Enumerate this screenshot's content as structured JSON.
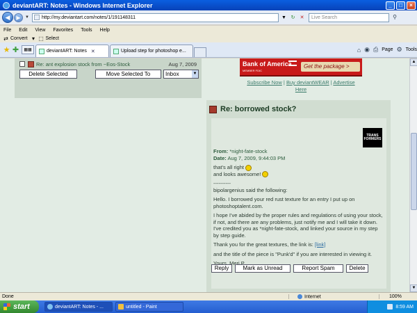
{
  "window": {
    "title": "deviantART: Notes - Windows Internet Explorer"
  },
  "address": {
    "url": "http://my.deviantart.com/notes/1/191148311",
    "search_placeholder": "Live Search"
  },
  "menu": {
    "items": [
      "File",
      "Edit",
      "View",
      "Favorites",
      "Tools",
      "Help"
    ]
  },
  "links_toolbar": {
    "convert": "Convert",
    "select": "Select"
  },
  "tabs": [
    {
      "label": "deviantART: Notes"
    },
    {
      "label": "Upload step for photoshop e..."
    }
  ],
  "command_bar": {
    "page": "Page",
    "tools": "Tools"
  },
  "list": {
    "row": {
      "from": "Re: ant explosion stock from ~Eos-Stock",
      "date": "Aug 7, 2009"
    },
    "delete_selected": "Delete Selected",
    "move_selected": "Move Selected To",
    "folder": "Inbox"
  },
  "ad": {
    "bank": "Bank of America",
    "member": "MEMBER FDIC",
    "cta": "Get the package >",
    "links": [
      "Subscribe Now",
      "Buy deviantWEAR",
      "Advertise",
      "Here"
    ],
    "sep": "|"
  },
  "note": {
    "title": "Re: borrowed stock?",
    "avatar_text": [
      "TRANS",
      "FORMERS"
    ],
    "from_label": "From:",
    "from": "*night-fate-stock",
    "date_label": "Date:",
    "date": "Aug 7, 2009, 9:44:03 PM",
    "line1": "that's all right",
    "line2": "and looks awesome!",
    "divider": "----------",
    "quote_intro": "bipolargenius said the following:",
    "para1": "Hello. I borrowed your red rust texture for an entry I put up on photoshoptalent.com.",
    "para2": "I hope I've abided by the proper rules and regulations of using your stock, if not, and there are any problems, just notify me and I will take it down.",
    "para3": "I've credited you as *night-fate-stock, and linked your source in my step by step guide.",
    "para4_prefix": "Thank you for the great textures, the link is: ",
    "para4_link": "[link]",
    "para5": "and the title of the piece is \"Punk'd\" if you are interested in viewing it.",
    "signoff": "Yours, Meri P.",
    "actions": [
      "Reply",
      "Mark as Unread",
      "Report Spam",
      "Delete"
    ]
  },
  "status": {
    "text": "Done",
    "zone": "Internet",
    "zoom": "100%"
  },
  "taskbar": {
    "start": "start",
    "tasks": [
      "deviantART: Notes - ...",
      "untitled - Paint"
    ],
    "clock": "8:59 AM"
  }
}
